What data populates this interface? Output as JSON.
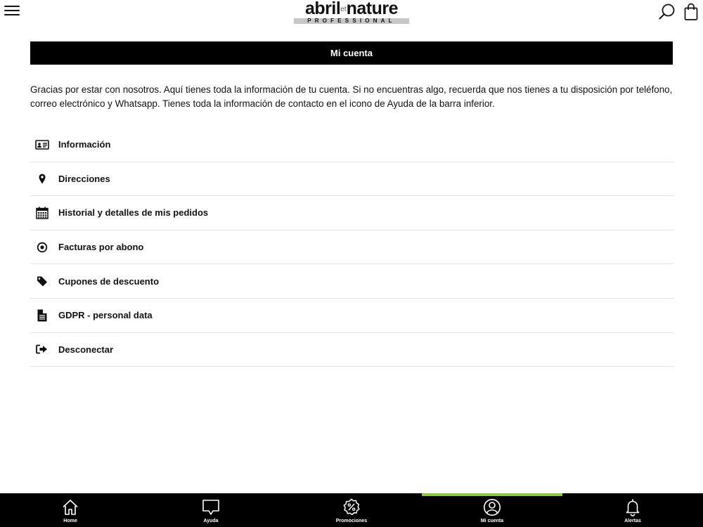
{
  "header": {
    "logo_main_left": "abril",
    "logo_main_et": "et",
    "logo_main_right": "nature",
    "logo_sub": "PROFESSIONAL",
    "menu_icon": "hamburger-icon",
    "search_icon": "search-icon",
    "cart_icon": "shopping-bag-icon"
  },
  "page": {
    "title": "Mi cuenta",
    "intro": "Gracias por estar con nosotros. Aquí tienes toda la información de tu cuenta. Si no encuentras algo, recuerda que nos tienes a tu disposición por teléfono, correo electrónico y Whatsapp. Tienes toda la información de contacto en el icono de Ayuda de la barra inferior."
  },
  "menu": {
    "items": [
      {
        "label": "Información",
        "icon": "id-card-icon"
      },
      {
        "label": "Direcciones",
        "icon": "map-pin-icon"
      },
      {
        "label": "Historial y detalles de mis pedidos",
        "icon": "calendar-icon"
      },
      {
        "label": "Facturas por abono",
        "icon": "dot-circle-icon"
      },
      {
        "label": "Cupones de descuento",
        "icon": "tag-icon"
      },
      {
        "label": "GDPR - personal data",
        "icon": "document-icon"
      },
      {
        "label": "Desconectar",
        "icon": "sign-out-icon"
      }
    ]
  },
  "bottom_nav": {
    "active_color": "#8dc63f",
    "items": [
      {
        "label": "Home",
        "icon": "home-icon",
        "active": false
      },
      {
        "label": "Ayuda",
        "icon": "chat-bubble-icon",
        "active": false
      },
      {
        "label": "Promociones",
        "icon": "percent-badge-icon",
        "active": false
      },
      {
        "label": "Mi cuenta",
        "icon": "user-circle-icon",
        "active": true
      },
      {
        "label": "Alertas",
        "icon": "bell-icon",
        "active": false
      }
    ]
  }
}
